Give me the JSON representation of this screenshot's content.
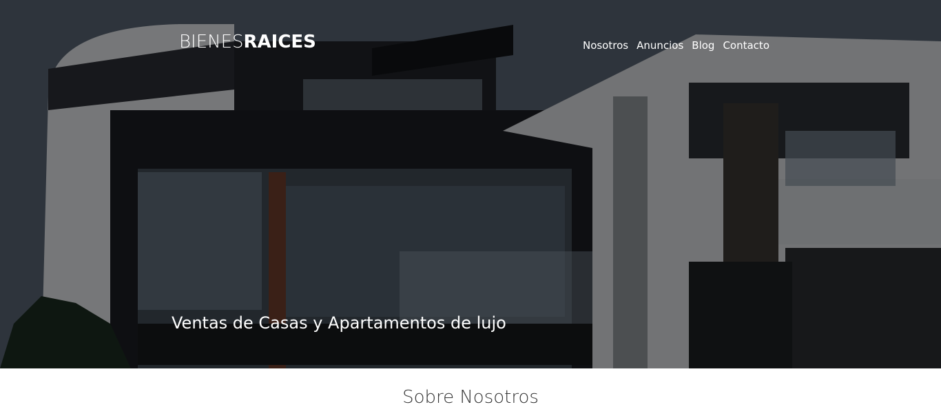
{
  "header": {
    "logo_light": "BIENES",
    "logo_bold": "RAICES",
    "nav": [
      "Nosotros",
      "Anuncios",
      "Blog",
      "Contacto"
    ]
  },
  "hero": {
    "tagline": "Ventas de Casas y Apartamentos de lujo"
  },
  "section": {
    "title": "Sobre Nosotros"
  },
  "colors": {
    "text_light": "#ffffff",
    "title_dark": "#333333"
  }
}
